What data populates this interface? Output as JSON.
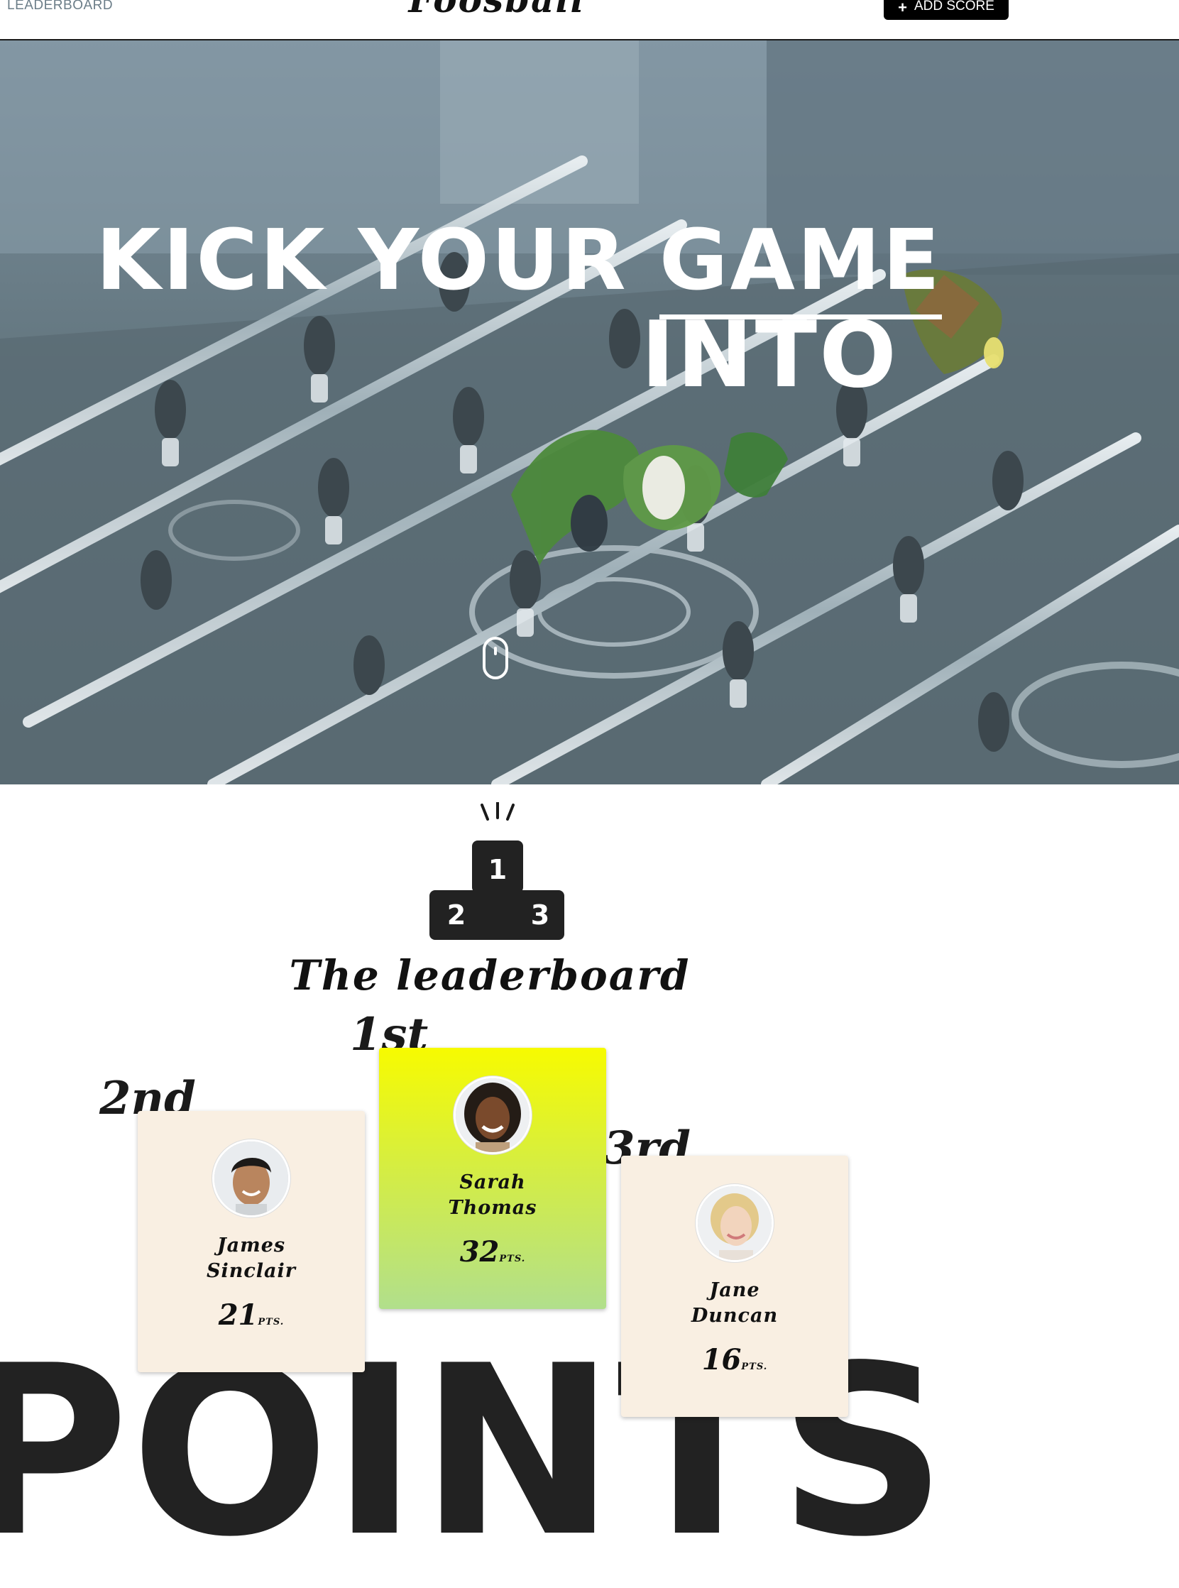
{
  "header": {
    "nav_leaderboard": "LEADERBOARD",
    "brand": "Foosball",
    "add_score": "ADD SCORE",
    "add_score_icon": "plus-icon"
  },
  "hero": {
    "headline_line1": "KICK YOUR",
    "headline_underlined": "GAME",
    "headline_line2": "INTO",
    "scroll_icon": "mouse-scroll-icon"
  },
  "leaderboard": {
    "podium_labels": [
      "1",
      "2",
      "3"
    ],
    "title": "The leaderboard",
    "places": [
      "1st",
      "2nd",
      "3rd"
    ],
    "background_word": "POINTS",
    "pts_suffix": "PTS.",
    "players": [
      {
        "rank": "2nd",
        "first": "James",
        "last": "Sinclair",
        "points": "21"
      },
      {
        "rank": "1st",
        "first": "Sarah",
        "last": "Thomas",
        "points": "32"
      },
      {
        "rank": "3rd",
        "first": "Jane",
        "last": "Duncan",
        "points": "16"
      }
    ]
  },
  "colors": {
    "accent_gold": "#f7fb00",
    "accent_green": "#b1df8c",
    "card_beige": "#f9efe2",
    "dark": "#1a1a1a"
  }
}
